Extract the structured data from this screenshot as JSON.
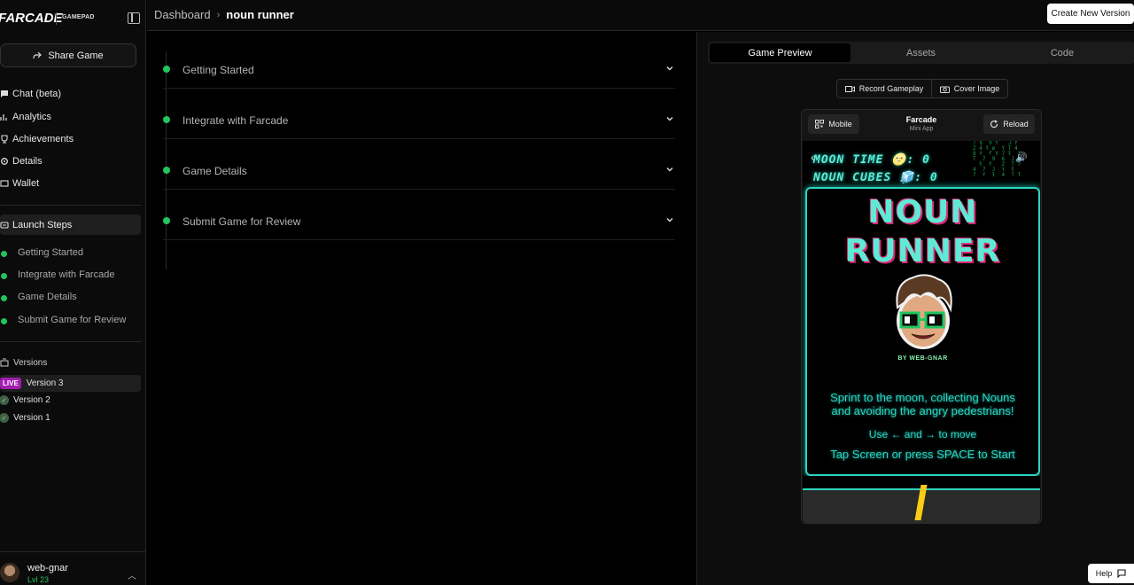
{
  "brand": {
    "logo": "FARCADE",
    "sub": "GAMEPAD"
  },
  "sidebar": {
    "share_label": "Share Game",
    "nav": [
      {
        "label": "Chat (beta)"
      },
      {
        "label": "Analytics"
      },
      {
        "label": "Achievements"
      },
      {
        "label": "Details"
      },
      {
        "label": "Wallet"
      }
    ],
    "launch_label": "Launch Steps",
    "launch_steps": [
      {
        "label": "Getting Started"
      },
      {
        "label": "Integrate with Farcade"
      },
      {
        "label": "Game Details"
      },
      {
        "label": "Submit Game for Review"
      }
    ],
    "versions_label": "Versions",
    "versions": [
      {
        "label": "Version 3",
        "badge": "LIVE"
      },
      {
        "label": "Version 2"
      },
      {
        "label": "Version 1"
      }
    ],
    "user": {
      "name": "web-gnar",
      "level": "Lvl 23"
    }
  },
  "topbar": {
    "breadcrumb": [
      "Dashboard",
      "noun runner"
    ],
    "create_label": "Create New Version"
  },
  "steps": [
    {
      "title": "Getting Started"
    },
    {
      "title": "Integrate with Farcade"
    },
    {
      "title": "Game Details"
    },
    {
      "title": "Submit Game for Review"
    }
  ],
  "preview": {
    "tabs": [
      {
        "label": "Game Preview",
        "active": true
      },
      {
        "label": "Assets"
      },
      {
        "label": "Code"
      }
    ],
    "record_label": "Record Gameplay",
    "cover_label": "Cover Image",
    "phone": {
      "mobile_label": "Mobile",
      "title": "Farcade",
      "subtitle": "Mini App",
      "reload_label": "Reload"
    },
    "game": {
      "hud_moon": "MOON TIME 🌝: 0",
      "hud_cubes": "NOUN CUBES 🧊: 0",
      "title_line1": "NOUN",
      "title_line2": "RUNNER",
      "byline": "BY WEB-GNAR",
      "tagline1": "Sprint to the moon, collecting Nouns",
      "tagline2": "and avoiding the angry pedestrians!",
      "controls": "Use ← and → to move",
      "start": "Tap Screen or press SPACE to Start"
    }
  },
  "help_label": "Help",
  "colors": {
    "accent_green": "#22c55e",
    "live_badge": "#a21caf",
    "game_cyan": "#2dd4bf",
    "game_pink": "#db2777"
  }
}
